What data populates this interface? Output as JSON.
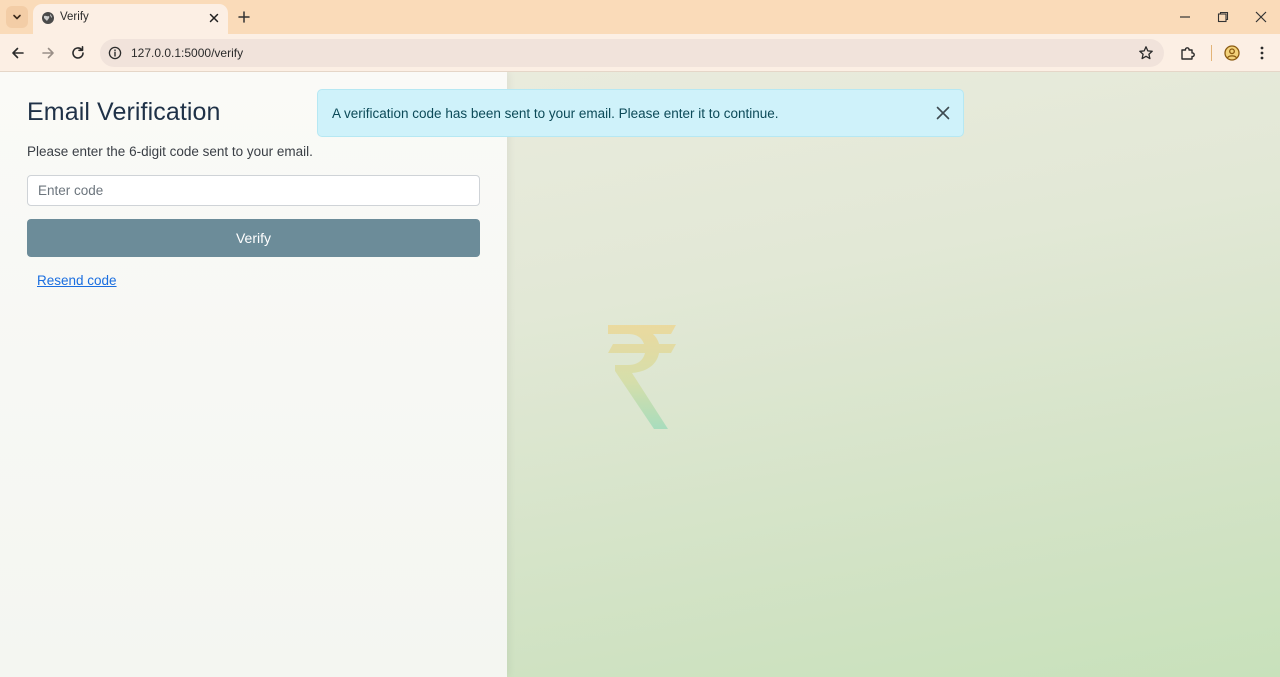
{
  "browser": {
    "tab": {
      "title": "Verify"
    },
    "url": "127.0.0.1:5000/verify"
  },
  "page": {
    "title": "Email Verification",
    "instruction": "Please enter the 6-digit code sent to your email.",
    "code_input": {
      "placeholder": "Enter code",
      "value": ""
    },
    "verify_button": "Verify",
    "resend_link": "Resend code"
  },
  "alert": {
    "message": "A verification code has been sent to your email. Please enter it to continue."
  },
  "colors": {
    "tabbar": "#fadbb9",
    "toolbar": "#fcefe4",
    "verify_button": "#6c8c99",
    "alert_background": "#cff2fa",
    "link": "#1a6ee0"
  },
  "icons": {
    "tab_list": "chevron-down-icon",
    "favicon": "globe-icon",
    "tab_close": "close-icon",
    "new_tab": "plus-icon",
    "back": "arrow-left-icon",
    "forward": "arrow-right-icon",
    "reload": "reload-icon",
    "site_info": "info-icon",
    "bookmark": "star-icon",
    "extensions": "puzzle-icon",
    "profile": "profile-icon",
    "menu": "kebab-menu-icon",
    "alert_close": "close-icon",
    "watermark": "rupee-icon"
  }
}
